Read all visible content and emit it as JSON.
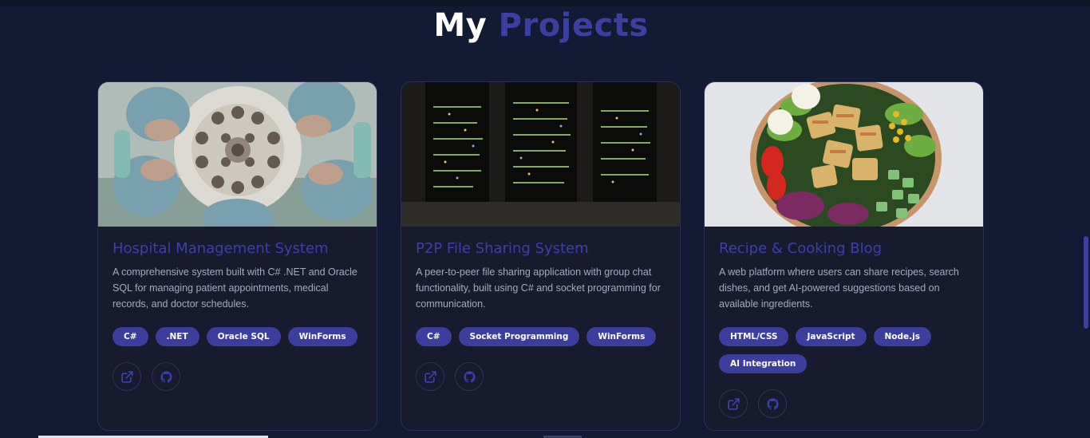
{
  "section": {
    "title_white": "My",
    "title_accent": "Projects"
  },
  "projects": [
    {
      "title": "Hospital Management System",
      "description": "A comprehensive system built with C# .NET and Oracle SQL for managing patient appointments, medical records, and doctor schedules.",
      "tags": [
        "C#",
        ".NET",
        "Oracle SQL",
        "WinForms"
      ],
      "image": "surgeons-looking-down-photo"
    },
    {
      "title": "P2P File Sharing System",
      "description": "A peer-to-peer file sharing application with group chat functionality, built using C# and socket programming for communication.",
      "tags": [
        "C#",
        "Socket Programming",
        "WinForms"
      ],
      "image": "server-rack-lights-photo"
    },
    {
      "title": "Recipe & Cooking Blog",
      "description": "A web platform where users can share recipes, search dishes, and get AI-powered suggestions based on available ingredients.",
      "tags": [
        "HTML/CSS",
        "JavaScript",
        "Node.js",
        "AI Integration"
      ],
      "image": "salad-bowl-photo"
    }
  ],
  "icons": {
    "external_link": "external-link-icon",
    "github": "github-icon"
  },
  "colors": {
    "background": "#131a33",
    "card": "#181a2d",
    "accent": "#3b40a8",
    "tag_bg": "#3b3e9c"
  }
}
